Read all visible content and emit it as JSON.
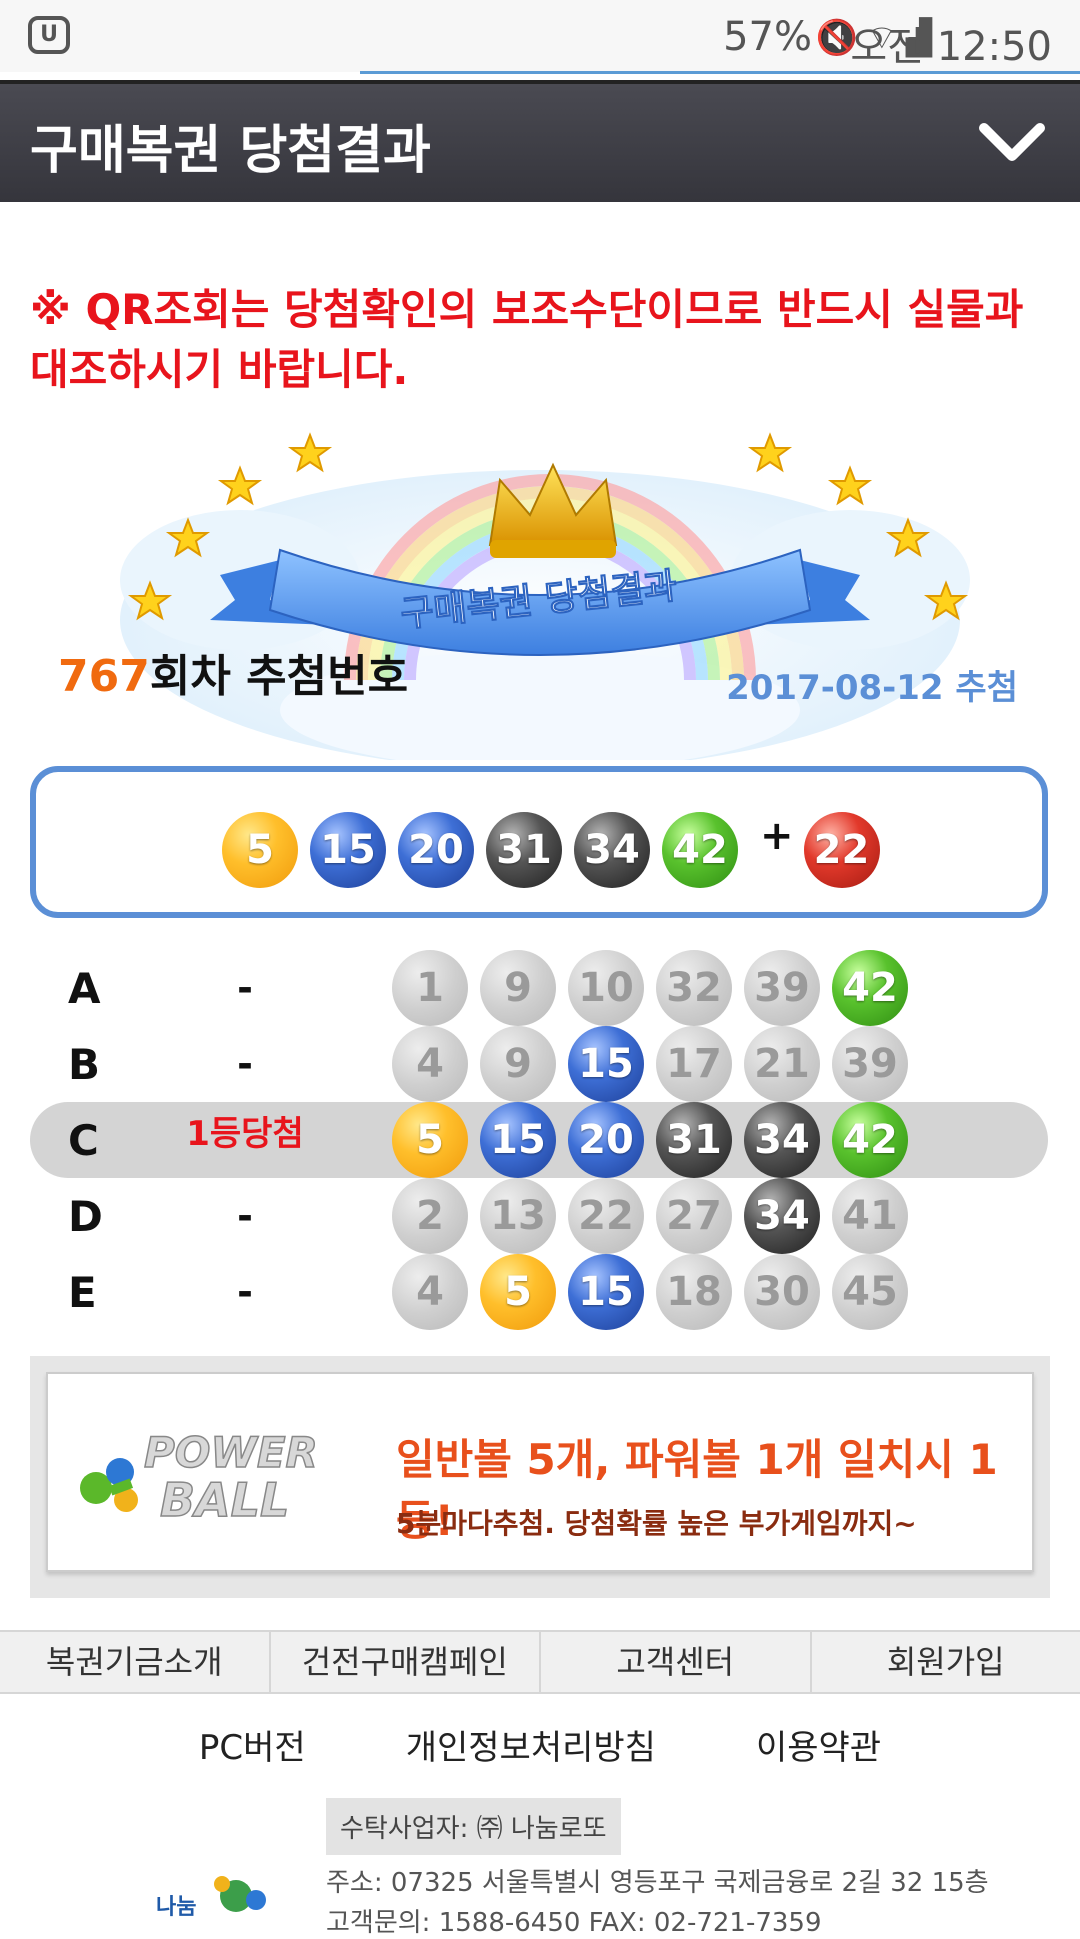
{
  "status_bar": {
    "app_icon": "U+-app-icon",
    "battery": "57%",
    "time": "오전 12:50",
    "icons": [
      "mute-icon",
      "wifi-icon",
      "signal-icon",
      "battery-icon"
    ]
  },
  "header": {
    "title": "구매복권 당첨결과",
    "toggle_icon": "chevron-down-icon"
  },
  "notice": "※ QR조회는 당첨확인의 보조수단이므로 반드시 실물과 대조하시기 바랍니다.",
  "banner": {
    "ribbon_text": "구매복권 당첨결과"
  },
  "draw": {
    "round": "767",
    "round_suffix": "회차 추첨번호",
    "date": "2017-08-12 추첨"
  },
  "winning_numbers": {
    "balls": [
      {
        "n": "5",
        "color": "yellow"
      },
      {
        "n": "15",
        "color": "blue"
      },
      {
        "n": "20",
        "color": "blue"
      },
      {
        "n": "31",
        "color": "black"
      },
      {
        "n": "34",
        "color": "black"
      },
      {
        "n": "42",
        "color": "green"
      }
    ],
    "plus": "+",
    "bonus": {
      "n": "22",
      "color": "red"
    }
  },
  "tickets": [
    {
      "letter": "A",
      "result": "-",
      "highlight": false,
      "balls": [
        {
          "n": "1",
          "color": "gray"
        },
        {
          "n": "9",
          "color": "gray"
        },
        {
          "n": "10",
          "color": "gray"
        },
        {
          "n": "32",
          "color": "gray"
        },
        {
          "n": "39",
          "color": "gray"
        },
        {
          "n": "42",
          "color": "green"
        }
      ]
    },
    {
      "letter": "B",
      "result": "-",
      "highlight": false,
      "balls": [
        {
          "n": "4",
          "color": "gray"
        },
        {
          "n": "9",
          "color": "gray"
        },
        {
          "n": "15",
          "color": "blue"
        },
        {
          "n": "17",
          "color": "gray"
        },
        {
          "n": "21",
          "color": "gray"
        },
        {
          "n": "39",
          "color": "gray"
        }
      ]
    },
    {
      "letter": "C",
      "result": "1등당첨",
      "highlight": true,
      "balls": [
        {
          "n": "5",
          "color": "yellow"
        },
        {
          "n": "15",
          "color": "blue"
        },
        {
          "n": "20",
          "color": "blue"
        },
        {
          "n": "31",
          "color": "black"
        },
        {
          "n": "34",
          "color": "black"
        },
        {
          "n": "42",
          "color": "green"
        }
      ]
    },
    {
      "letter": "D",
      "result": "-",
      "highlight": false,
      "balls": [
        {
          "n": "2",
          "color": "gray"
        },
        {
          "n": "13",
          "color": "gray"
        },
        {
          "n": "22",
          "color": "gray"
        },
        {
          "n": "27",
          "color": "gray"
        },
        {
          "n": "34",
          "color": "black"
        },
        {
          "n": "41",
          "color": "gray"
        }
      ]
    },
    {
      "letter": "E",
      "result": "-",
      "highlight": false,
      "balls": [
        {
          "n": "4",
          "color": "gray"
        },
        {
          "n": "5",
          "color": "yellow"
        },
        {
          "n": "15",
          "color": "blue"
        },
        {
          "n": "18",
          "color": "gray"
        },
        {
          "n": "30",
          "color": "gray"
        },
        {
          "n": "45",
          "color": "gray"
        }
      ]
    }
  ],
  "ad": {
    "logo_line1": "POWER",
    "logo_line2": "BALL",
    "line1": "일반볼 5개, 파워볼 1개 일치시 1등!",
    "line2": "5분마다추첨. 당첨확률 높은 부가게임까지~"
  },
  "footer_nav": [
    "복권기금소개",
    "건전구매캠페인",
    "고객센터",
    "회원가입"
  ],
  "footer_links": [
    "PC버전",
    "개인정보처리방침",
    "이용약관"
  ],
  "company": {
    "operator": "수탁사업자: ㈜ 나눔로또",
    "address": "주소: 07325 서울특별시 영등포구 국제금융로 2길 32 15층",
    "contact": "고객문의: 1588-6450 FAX: 02-721-7359",
    "logo_text": "나눔"
  },
  "colors": {
    "header_bg": "#3f3f46",
    "notice_red": "#e8141c",
    "round_orange": "#f06a0f",
    "date_blue": "#5b8fd6",
    "box_border": "#5b8fd6"
  }
}
